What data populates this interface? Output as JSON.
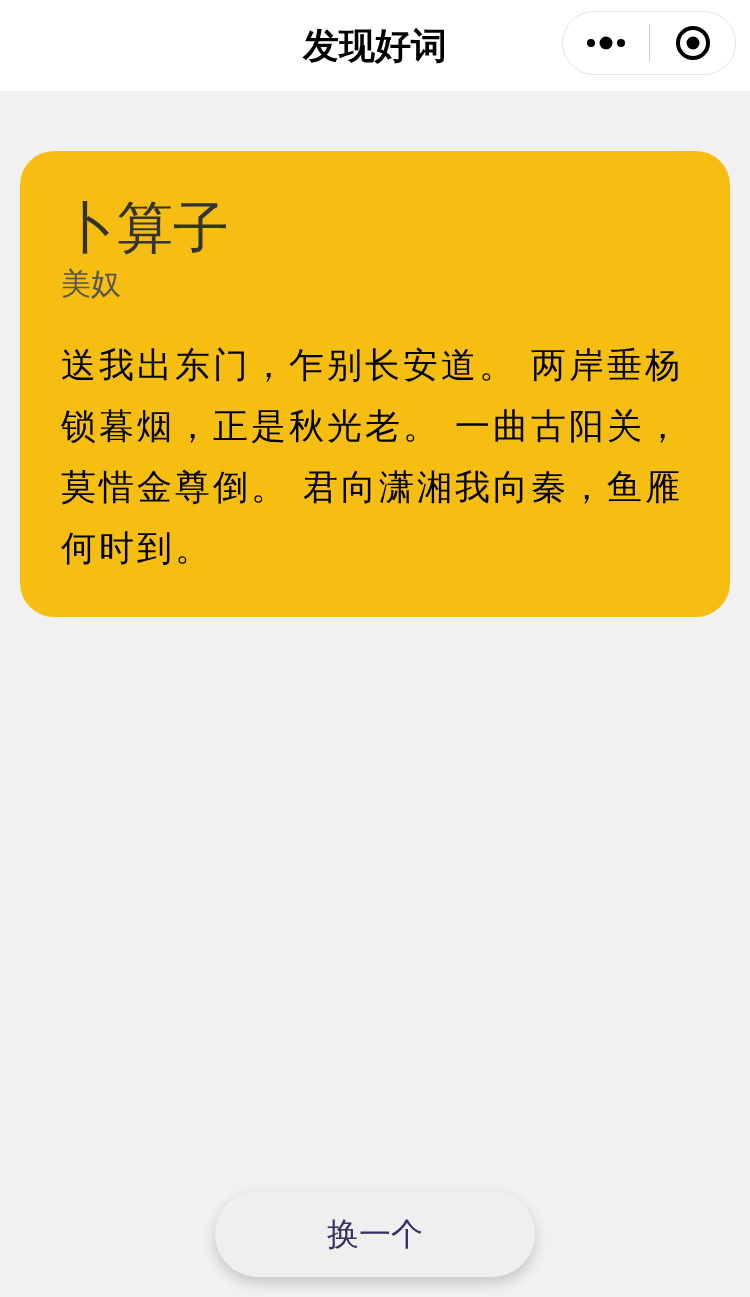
{
  "navbar": {
    "title": "发现好词"
  },
  "poem": {
    "title": "卜算子",
    "author": "美奴",
    "text": "送我出东门，乍别长安道。 两岸垂杨锁暮烟，正是秋光老。 一曲古阳关，莫惜金尊倒。 君向潇湘我向秦，鱼雁何时到。"
  },
  "button": {
    "label": "换一个"
  }
}
